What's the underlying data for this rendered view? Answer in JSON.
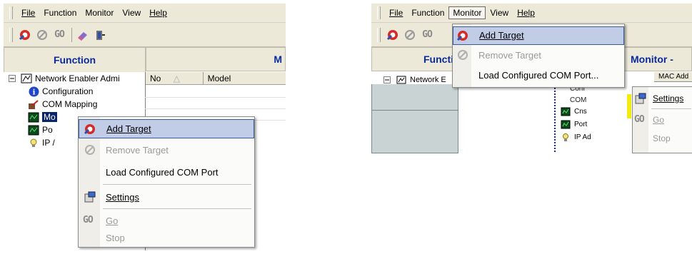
{
  "menu": {
    "file": "File",
    "function": "Function",
    "monitor": "Monitor",
    "view": "View",
    "help": "Help"
  },
  "toolbar": {
    "go_label": "GO"
  },
  "left": {
    "function_header": "Function",
    "monitor_header": "M",
    "tree": {
      "root": "Network Enabler Admi",
      "items": [
        "Configuration",
        "COM Mapping",
        "Mo",
        "Po",
        "IP /"
      ]
    },
    "grid": {
      "col_no": "No",
      "col_model": "Model"
    },
    "context_menu": {
      "add_target": "Add Target",
      "remove_target": "Remove Target",
      "load_com": "Load Configured COM Port",
      "settings": "Settings",
      "go": "Go",
      "stop": "Stop",
      "go_icon_text": "GO"
    }
  },
  "right": {
    "function_header": "Functi",
    "monitor_header": "Monitor -",
    "tree_root": "Network E",
    "mac_header": "MAC Add",
    "tree_fragments": [
      "Conf",
      "COM",
      "Cns",
      "Port",
      "IP Ad"
    ],
    "dropdown": {
      "add_target": "Add Target",
      "remove_target": "Remove Target",
      "load_com": "Load Configured COM Port..."
    },
    "submenu": {
      "settings": "Settings",
      "go": "Go",
      "stop": "Stop",
      "go_icon_text": "GO"
    }
  },
  "colors": {
    "header_text": "#0a2a9e",
    "highlight": "#c1cde6",
    "chrome": "#ece9d8"
  }
}
